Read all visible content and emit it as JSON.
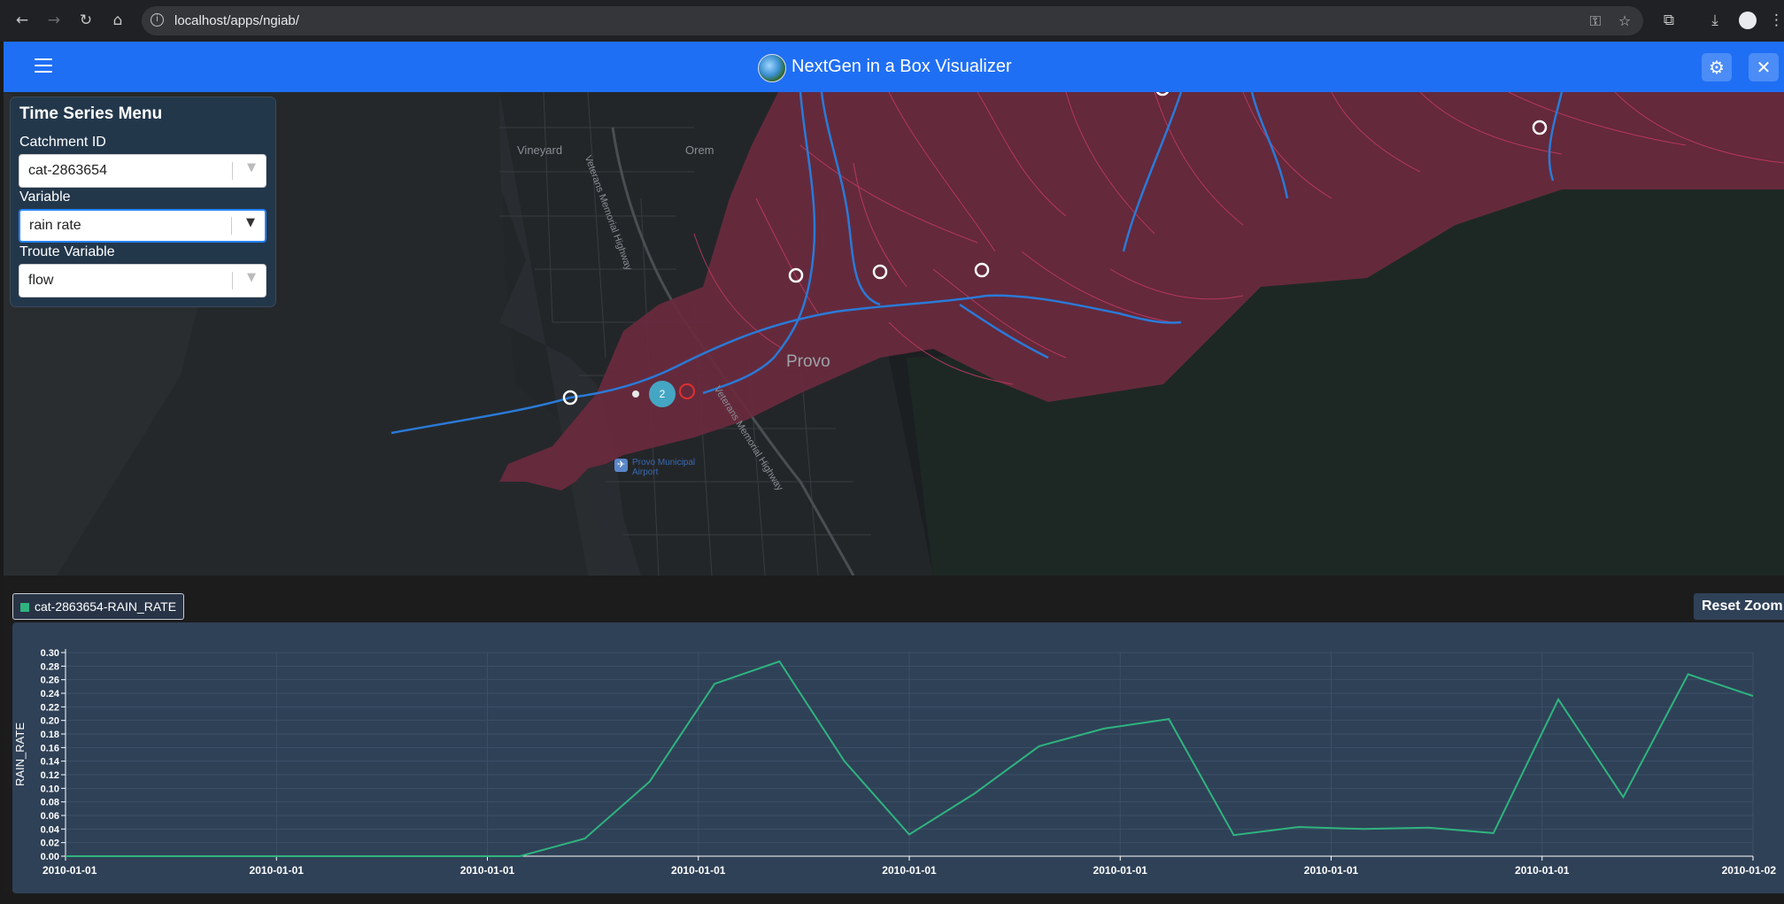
{
  "browser": {
    "url": "localhost/apps/ngiab/",
    "icons": [
      "back-icon",
      "forward-icon",
      "reload-icon",
      "home-icon",
      "site-info-icon",
      "key-icon",
      "star-icon",
      "extensions-icon",
      "download-icon",
      "profile-icon",
      "more-icon"
    ]
  },
  "header": {
    "title": "NextGen in a Box Visualizer",
    "icons": [
      "menu-icon",
      "app-logo",
      "settings-icon",
      "close-icon"
    ],
    "brand_color": "#1f6ff4"
  },
  "map": {
    "labels": {
      "vineyard": "Vineyard",
      "orem": "Orem",
      "provo": "Provo",
      "airport": "Provo Municipal Airport",
      "highway_1": "Veterans Memorial Highway",
      "highway_2": "Veterans Memorial Highway"
    },
    "cluster_count": "2",
    "colors": {
      "catchment": "#6a2a3e",
      "stream": "#2a7ad8",
      "boundary": "#c43a62"
    }
  },
  "ts_menu": {
    "title": "Time Series Menu",
    "catchment_label": "Catchment ID",
    "catchment_value": "cat-2863654",
    "variable_label": "Variable",
    "variable_value": "rain rate",
    "troute_label": "Troute Variable",
    "troute_value": "flow"
  },
  "chart_controls": {
    "legend_label": "cat-2863654-RAIN_RATE",
    "reset_label": "Reset Zoom"
  },
  "chart_data": {
    "type": "line",
    "ylabel": "RAIN_RATE",
    "xlabel": "",
    "ylim": [
      0,
      0.3
    ],
    "yticks": [
      "0.00",
      "0.02",
      "0.04",
      "0.06",
      "0.08",
      "0.10",
      "0.12",
      "0.14",
      "0.16",
      "0.18",
      "0.20",
      "0.22",
      "0.24",
      "0.26",
      "0.28",
      "0.30"
    ],
    "xticks": [
      "2010-01-01",
      "2010-01-01",
      "2010-01-01",
      "2010-01-01",
      "2010-01-01",
      "2010-01-01",
      "2010-01-01",
      "2010-01-01",
      "2010-01-02"
    ],
    "grid": true,
    "series": [
      {
        "name": "cat-2863654-RAIN_RATE",
        "color": "#2fb47f",
        "values": [
          0,
          0,
          0,
          0,
          0,
          0,
          0,
          0.0,
          0.026,
          0.11,
          0.254,
          0.287,
          0.14,
          0.032,
          0.092,
          0.162,
          0.188,
          0.202,
          0.031,
          0.043,
          0.04,
          0.042,
          0.034,
          0.231,
          0.087,
          0.268,
          0.236
        ]
      }
    ]
  }
}
